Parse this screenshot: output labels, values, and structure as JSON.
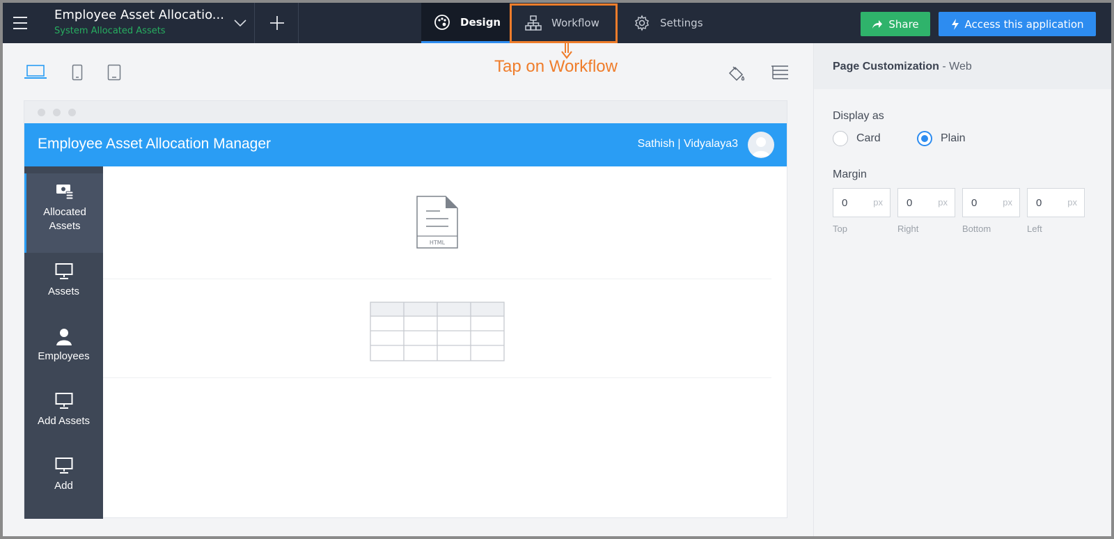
{
  "topbar": {
    "app_title": "Employee Asset Allocatio...",
    "app_subtitle": "System Allocated Assets",
    "tabs": [
      {
        "label": "Design",
        "icon": "palette-icon",
        "active": true
      },
      {
        "label": "Workflow",
        "icon": "workflow-icon",
        "active": false
      },
      {
        "label": "Settings",
        "icon": "gear-icon",
        "active": false
      }
    ],
    "share_label": "Share",
    "access_label": "Access this application"
  },
  "annotation": {
    "text": "Tap on Workflow",
    "color": "#ef7d2b"
  },
  "device_toolbar": {
    "devices": [
      "laptop-icon",
      "tablet-portrait-icon",
      "tablet-icon"
    ],
    "tools": [
      "paint-bucket-icon",
      "page-structure-icon"
    ]
  },
  "preview": {
    "header_title": "Employee Asset Allocation Manager",
    "user": "Sathish | Vidyalaya3",
    "header_color": "#2a9df4",
    "nav": [
      {
        "label": "Allocated Assets",
        "icon": "allocated-assets-icon",
        "active": true
      },
      {
        "label": "Assets",
        "icon": "monitor-icon",
        "active": false
      },
      {
        "label": "Employees",
        "icon": "person-icon",
        "active": false
      },
      {
        "label": "Add Assets",
        "icon": "monitor-icon",
        "active": false
      },
      {
        "label": "Add",
        "icon": "monitor-icon",
        "active": false
      }
    ],
    "components": [
      {
        "type": "html",
        "label": "HTML"
      },
      {
        "type": "table"
      }
    ]
  },
  "panel": {
    "title_bold": "Page Customization",
    "title_rest": " - Web",
    "display_as_label": "Display as",
    "display_options": [
      {
        "label": "Card",
        "selected": false
      },
      {
        "label": "Plain",
        "selected": true
      }
    ],
    "margin_label": "Margin",
    "margins": [
      {
        "caption": "Top",
        "value": "0",
        "unit": "px"
      },
      {
        "caption": "Right",
        "value": "0",
        "unit": "px"
      },
      {
        "caption": "Bottom",
        "value": "0",
        "unit": "px"
      },
      {
        "caption": "Left",
        "value": "0",
        "unit": "px"
      }
    ]
  }
}
